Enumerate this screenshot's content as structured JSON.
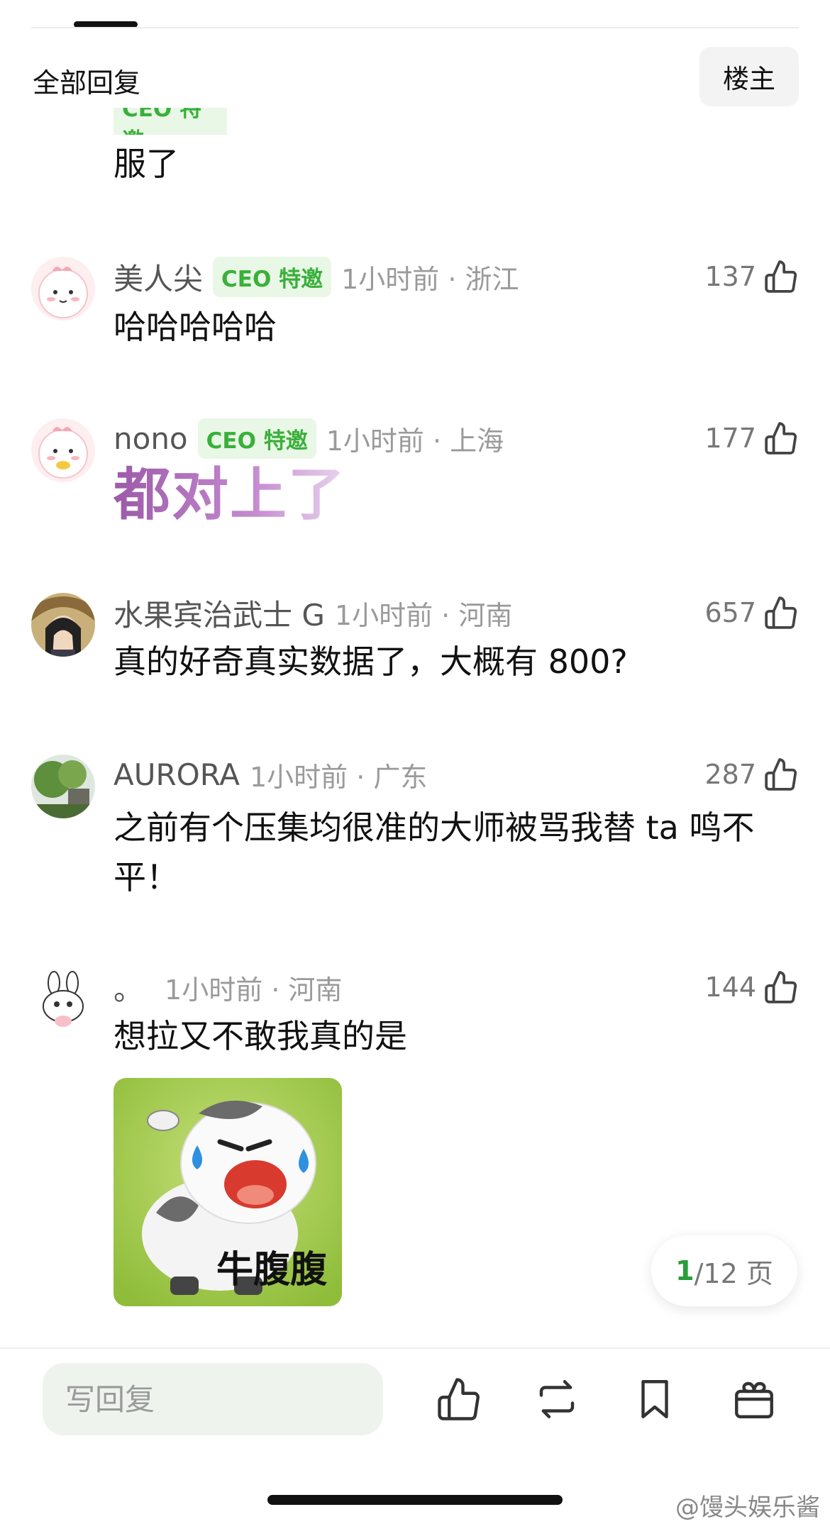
{
  "header": {
    "title": "全部回复",
    "op_button": "楼主"
  },
  "partial_comment": {
    "text": "服了",
    "badge": "CEO 特邀"
  },
  "comments": [
    {
      "username": "美人尖",
      "badge": "CEO 特邀",
      "time": "1小时前 · 浙江",
      "likes": "137",
      "text": "哈哈哈哈哈"
    },
    {
      "username": "nono",
      "badge": "CEO 特邀",
      "time": "1小时前 · 上海",
      "likes": "177",
      "text": "都对上了"
    },
    {
      "username": "水果宾治武士 G",
      "time": "1小时前 · 河南",
      "likes": "657",
      "text": "真的好奇真实数据了，大概有 800?"
    },
    {
      "username": "AURORA",
      "time": "1小时前 · 广东",
      "likes": "287",
      "text": "之前有个压集均很准的大师被骂我替 ta 鸣不平！"
    },
    {
      "username": "。",
      "time": "1小时前 · 河南",
      "likes": "144",
      "text": "想拉又不敢我真的是",
      "sticker_label": "牛腹腹"
    }
  ],
  "pager": {
    "current": "1",
    "total": "/12 页"
  },
  "bottom_bar": {
    "reply_placeholder": "写回复"
  },
  "watermark": "@馒头娱乐酱",
  "colors": {
    "accent_green": "#39b03a",
    "badge_bg": "#e9f7e6",
    "pager_current": "#2a9d3a"
  }
}
